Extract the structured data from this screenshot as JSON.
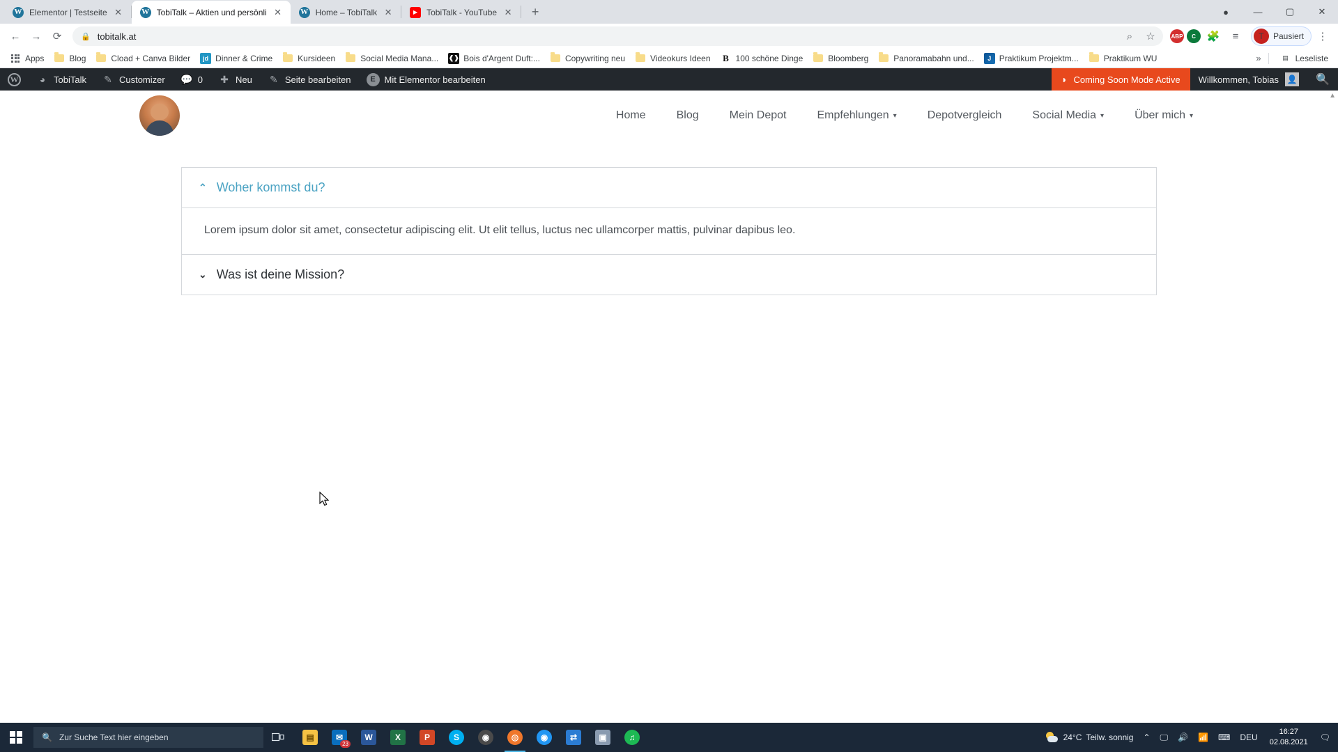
{
  "browser": {
    "tabs": [
      {
        "title": "Elementor | Testseite",
        "favicon": "wordpress-icon",
        "active": false
      },
      {
        "title": "TobiTalk – Aktien und persönlich",
        "favicon": "wordpress-icon",
        "active": true
      },
      {
        "title": "Home – TobiTalk",
        "favicon": "wordpress-icon",
        "active": false
      },
      {
        "title": "TobiTalk - YouTube",
        "favicon": "youtube-icon",
        "active": false
      }
    ],
    "new_tab_label": "+",
    "window_controls": {
      "minimize": "—",
      "maximize": "▢",
      "close": "✕",
      "extra": "●"
    },
    "nav": {
      "back": "←",
      "forward": "→",
      "reload": "⟳"
    },
    "omnibox": {
      "url": "tobitalk.at",
      "lock": "🔒",
      "zoom_icon": "zoom-search-icon",
      "bookmark_icon": "star-icon"
    },
    "extensions": [
      {
        "name": "adblock-plus-icon",
        "label": "ABP"
      },
      {
        "name": "c-extension-icon",
        "label": "C"
      },
      {
        "name": "puzzle-extensions-icon",
        "label": "🧩"
      },
      {
        "name": "playlist-icon",
        "label": "≡♪"
      }
    ],
    "profile": {
      "initial": "T",
      "label": "Pausiert"
    },
    "menu_icon": "⋮",
    "bookmarks": [
      {
        "label": "Apps",
        "icon": "apps-grid-icon"
      },
      {
        "label": "Blog",
        "icon": "folder-icon"
      },
      {
        "label": "Cload + Canva Bilder",
        "icon": "folder-icon"
      },
      {
        "label": "Dinner & Crime",
        "icon": "jd-site-icon"
      },
      {
        "label": "Kursideen",
        "icon": "folder-icon"
      },
      {
        "label": "Social Media Mana...",
        "icon": "folder-icon"
      },
      {
        "label": "Bois d'Argent Duft:...",
        "icon": "bois-site-icon"
      },
      {
        "label": "Copywriting neu",
        "icon": "folder-icon"
      },
      {
        "label": "Videokurs Ideen",
        "icon": "folder-icon"
      },
      {
        "label": "100 schöne Dinge",
        "icon": "b-site-icon"
      },
      {
        "label": "Bloomberg",
        "icon": "folder-icon"
      },
      {
        "label": "Panoramabahn und...",
        "icon": "folder-icon"
      },
      {
        "label": "Praktikum Projektm...",
        "icon": "j-site-icon"
      },
      {
        "label": "Praktikum WU",
        "icon": "folder-icon"
      }
    ],
    "bookmarks_overflow": "»",
    "reading_list": {
      "label": "Leseliste",
      "icon": "reading-list-icon"
    }
  },
  "wp_admin_bar": {
    "logo": "W",
    "site_name": "TobiTalk",
    "customizer": "Customizer",
    "comments_count": "0",
    "new": "Neu",
    "edit_page": "Seite bearbeiten",
    "elementor": "Mit Elementor bearbeiten",
    "coming_soon": "Coming Soon Mode Active",
    "welcome": "Willkommen, Tobias",
    "search_icon": "search-icon"
  },
  "site": {
    "logo_alt": "tobitalk-avatar",
    "nav": [
      {
        "label": "Home",
        "has_dropdown": false
      },
      {
        "label": "Blog",
        "has_dropdown": false
      },
      {
        "label": "Mein Depot",
        "has_dropdown": false
      },
      {
        "label": "Empfehlungen",
        "has_dropdown": true
      },
      {
        "label": "Depotvergleich",
        "has_dropdown": false
      },
      {
        "label": "Social Media",
        "has_dropdown": true
      },
      {
        "label": "Über mich",
        "has_dropdown": true
      }
    ],
    "accordion": [
      {
        "title": "Woher kommst du?",
        "expanded": true,
        "arrow": "⌃",
        "body": "Lorem ipsum dolor sit amet, consectetur adipiscing elit. Ut elit tellus, luctus nec ullamcorper mattis, pulvinar dapibus leo."
      },
      {
        "title": "Was ist deine Mission?",
        "expanded": false,
        "arrow": "⌄",
        "body": ""
      }
    ],
    "accent_color": "#4ba3c3"
  },
  "taskbar": {
    "start_icon": "windows-start-icon",
    "search_placeholder": "Zur Suche Text hier eingeben",
    "search_icon": "search-icon",
    "task_view_icon": "task-view-icon",
    "apps": [
      {
        "name": "file-explorer-icon",
        "glyph": "🗀",
        "color": "#f6c244",
        "badge": ""
      },
      {
        "name": "mail-icon",
        "glyph": "23",
        "color": "#0a6ebd",
        "badge": "23"
      },
      {
        "name": "word-icon",
        "glyph": "W",
        "color": "#2b579a",
        "badge": ""
      },
      {
        "name": "excel-icon",
        "glyph": "X",
        "color": "#217346",
        "badge": ""
      },
      {
        "name": "powerpoint-icon",
        "glyph": "P",
        "color": "#d24726",
        "badge": ""
      },
      {
        "name": "skype-icon",
        "glyph": "S",
        "color": "#00aff0",
        "badge": ""
      },
      {
        "name": "browser-alt-icon",
        "glyph": "◉",
        "color": "#4a4a4a",
        "badge": ""
      },
      {
        "name": "chrome-canary-icon",
        "glyph": "◎",
        "color": "#f0772b",
        "badge": ""
      },
      {
        "name": "chrome-icon",
        "glyph": "◉",
        "color": "#2196f3",
        "badge": ""
      },
      {
        "name": "sync-icon",
        "glyph": "⇄",
        "color": "#2b7cd3",
        "badge": ""
      },
      {
        "name": "photos-icon",
        "glyph": "🖼",
        "color": "#8a9bb0",
        "badge": ""
      },
      {
        "name": "spotify-icon",
        "glyph": "♫",
        "color": "#1db954",
        "badge": ""
      }
    ],
    "tray": {
      "weather_temp": "24°C",
      "weather_desc": "Teilw. sonnig",
      "weather_icon": "partly-sunny-icon",
      "overflow": "⌃",
      "screen_icon": "screen-share-icon",
      "volume_icon": "volume-icon",
      "network_icon": "wifi-icon",
      "keyboard_icon": "keyboard-icon",
      "language": "DEU",
      "time": "16:27",
      "date": "02.08.2021",
      "notification_icon": "notification-icon"
    }
  }
}
